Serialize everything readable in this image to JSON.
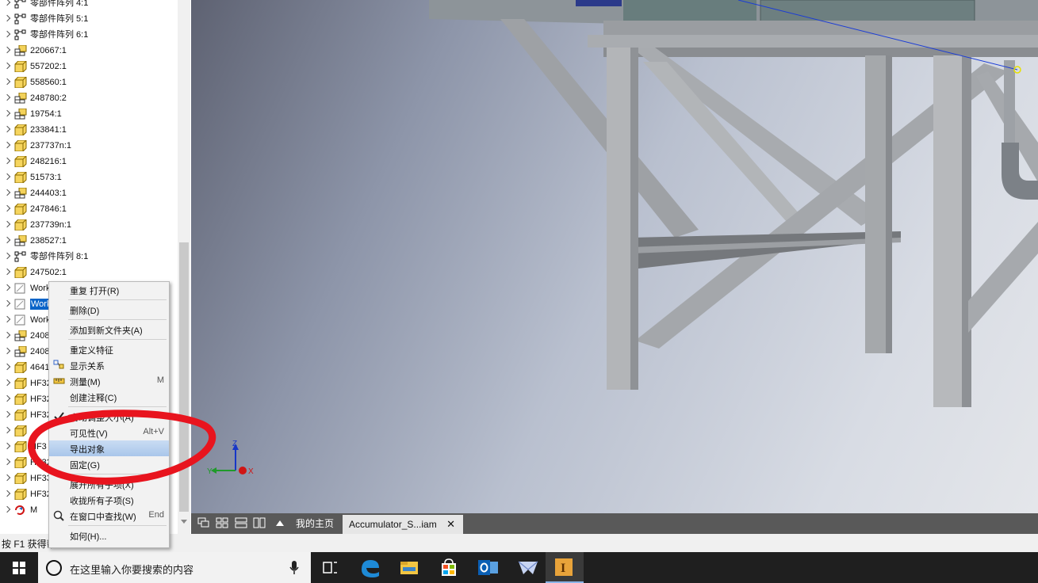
{
  "tree": {
    "items": [
      {
        "label": "零部件阵列 4:1",
        "icon": "pattern-icon"
      },
      {
        "label": "零部件阵列 5:1",
        "icon": "pattern-icon"
      },
      {
        "label": "零部件阵列 6:1",
        "icon": "pattern-icon"
      },
      {
        "label": "220667:1",
        "icon": "subassembly-icon"
      },
      {
        "label": "557202:1",
        "icon": "part-icon"
      },
      {
        "label": "558560:1",
        "icon": "part-icon"
      },
      {
        "label": "248780:2",
        "icon": "subassembly-icon"
      },
      {
        "label": "19754:1",
        "icon": "subassembly-icon"
      },
      {
        "label": "233841:1",
        "icon": "part-icon"
      },
      {
        "label": "237737n:1",
        "icon": "part-icon"
      },
      {
        "label": "248216:1",
        "icon": "part-icon"
      },
      {
        "label": "51573:1",
        "icon": "part-icon"
      },
      {
        "label": "244403:1",
        "icon": "subassembly-icon"
      },
      {
        "label": "247846:1",
        "icon": "part-icon"
      },
      {
        "label": "237739n:1",
        "icon": "part-icon"
      },
      {
        "label": "238527:1",
        "icon": "subassembly-icon"
      },
      {
        "label": "零部件阵列 8:1",
        "icon": "pattern-icon"
      },
      {
        "label": "247502:1",
        "icon": "part-icon"
      },
      {
        "label": "Work",
        "icon": "work-plane-icon"
      },
      {
        "label": "Work",
        "icon": "work-plane-icon",
        "selected": true
      },
      {
        "label": "Work",
        "icon": "work-plane-icon"
      },
      {
        "label": "2408",
        "icon": "subassembly-icon"
      },
      {
        "label": "2408",
        "icon": "subassembly-icon"
      },
      {
        "label": "4641",
        "icon": "part-icon"
      },
      {
        "label": "HF32",
        "icon": "part-icon"
      },
      {
        "label": "HF32",
        "icon": "part-icon"
      },
      {
        "label": "HF32",
        "icon": "part-icon"
      },
      {
        "label": "",
        "icon": "part-icon"
      },
      {
        "label": "HF3",
        "icon": "part-icon"
      },
      {
        "label": "HF32",
        "icon": "part-icon"
      },
      {
        "label": "HF33",
        "icon": "part-icon"
      },
      {
        "label": "HF32",
        "icon": "part-icon"
      },
      {
        "label": "M",
        "icon": "mirror-assembly-icon"
      }
    ]
  },
  "context_menu": {
    "items": [
      {
        "label": "重复 打开(R)",
        "shortcut": ""
      },
      {
        "label": "删除(D)",
        "shortcut": ""
      },
      {
        "label": "添加到新文件夹(A)",
        "shortcut": ""
      },
      {
        "label": "重定义特征",
        "shortcut": ""
      },
      {
        "label": "显示关系",
        "shortcut": "",
        "icon": "relationship-icon"
      },
      {
        "label": "测量(M)",
        "shortcut": "M",
        "icon": "measure-icon"
      },
      {
        "label": "创建注释(C)",
        "shortcut": ""
      },
      {
        "label": "自动调整大小(A)",
        "shortcut": "",
        "icon": "check-icon"
      },
      {
        "label": "可见性(V)",
        "shortcut": "Alt+V"
      },
      {
        "label": "导出对象",
        "shortcut": "",
        "highlighted": true
      },
      {
        "label": "固定(G)",
        "shortcut": ""
      },
      {
        "label": "展开所有子项(X)",
        "shortcut": ""
      },
      {
        "label": "收拢所有子项(S)",
        "shortcut": ""
      },
      {
        "label": "在窗口中查找(W)",
        "shortcut": "End",
        "icon": "find-icon"
      },
      {
        "label": "如何(H)...",
        "shortcut": ""
      }
    ]
  },
  "viewport": {
    "axis": {
      "x": "X",
      "y": "Y",
      "z": "Z"
    }
  },
  "tabs": {
    "home": "我的主页",
    "document": "Accumulator_S...iam",
    "close": "✕"
  },
  "status": {
    "text": "按 F1 获得帮助"
  },
  "taskbar": {
    "search_placeholder": "在这里输入你要搜索的内容",
    "apps": [
      "task-view-icon",
      "edge-icon",
      "file-explorer-icon",
      "store-icon",
      "outlook-icon",
      "feedback-icon",
      "inventor-icon"
    ]
  },
  "colors": {
    "selection": "#0a64c8",
    "menu_highlight": "#b6d0ee",
    "annotation": "#e8141e",
    "taskbar": "#1f1f1f",
    "tab_bar": "#595959"
  }
}
